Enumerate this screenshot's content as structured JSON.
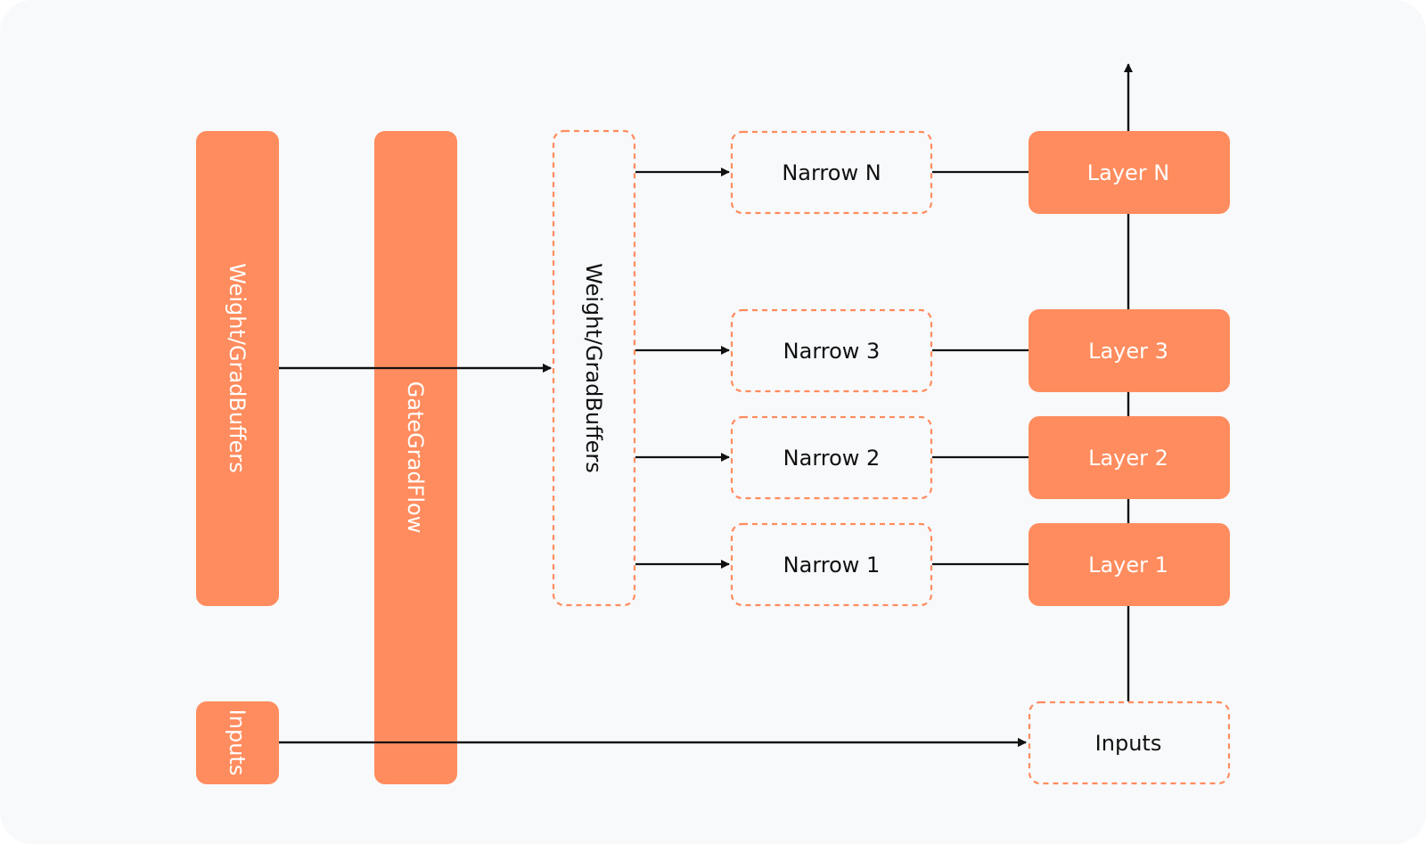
{
  "colors": {
    "background": "#f8f9fb",
    "accent": "#ff8c5e",
    "line": "#111111",
    "solid_text": "#ffffff",
    "dashed_text": "#111111"
  },
  "nodes": {
    "weight_grad_buffers_left": {
      "label": "Weight/GradBuffers",
      "style": "solid",
      "orientation": "vertical"
    },
    "gate_grad_flow": {
      "label": "GateGradFlow",
      "style": "solid",
      "orientation": "vertical"
    },
    "inputs_left": {
      "label": "Inputs",
      "style": "solid",
      "orientation": "vertical"
    },
    "weight_grad_buffers_mid": {
      "label": "Weight/GradBuffers",
      "style": "dashed",
      "orientation": "vertical"
    },
    "narrow_n": {
      "label": "Narrow N",
      "style": "dashed"
    },
    "narrow_3": {
      "label": "Narrow 3",
      "style": "dashed"
    },
    "narrow_2": {
      "label": "Narrow 2",
      "style": "dashed"
    },
    "narrow_1": {
      "label": "Narrow 1",
      "style": "dashed"
    },
    "layer_n": {
      "label": "Layer N",
      "style": "solid"
    },
    "layer_3": {
      "label": "Layer 3",
      "style": "solid"
    },
    "layer_2": {
      "label": "Layer 2",
      "style": "solid"
    },
    "layer_1": {
      "label": "Layer 1",
      "style": "solid"
    },
    "inputs_right": {
      "label": "Inputs",
      "style": "dashed"
    }
  },
  "edges": [
    {
      "from": "weight_grad_buffers_left",
      "to": "weight_grad_buffers_mid",
      "arrow": true
    },
    {
      "from": "weight_grad_buffers_mid",
      "to": "narrow_n",
      "arrow": true
    },
    {
      "from": "weight_grad_buffers_mid",
      "to": "narrow_3",
      "arrow": true
    },
    {
      "from": "weight_grad_buffers_mid",
      "to": "narrow_2",
      "arrow": true
    },
    {
      "from": "weight_grad_buffers_mid",
      "to": "narrow_1",
      "arrow": true
    },
    {
      "from": "narrow_n",
      "to": "layer_n",
      "arrow": false
    },
    {
      "from": "narrow_3",
      "to": "layer_3",
      "arrow": false
    },
    {
      "from": "narrow_2",
      "to": "layer_2",
      "arrow": false
    },
    {
      "from": "narrow_1",
      "to": "layer_1",
      "arrow": false
    },
    {
      "from": "inputs_left",
      "to": "inputs_right",
      "arrow": true
    },
    {
      "from": "inputs_right",
      "to": "layer_1",
      "arrow": false
    },
    {
      "from": "layer_1",
      "to": "layer_2",
      "arrow": false
    },
    {
      "from": "layer_2",
      "to": "layer_3",
      "arrow": false
    },
    {
      "from": "layer_3",
      "to": "layer_n",
      "arrow": false
    },
    {
      "from": "layer_n",
      "to": "output",
      "arrow": true
    }
  ]
}
